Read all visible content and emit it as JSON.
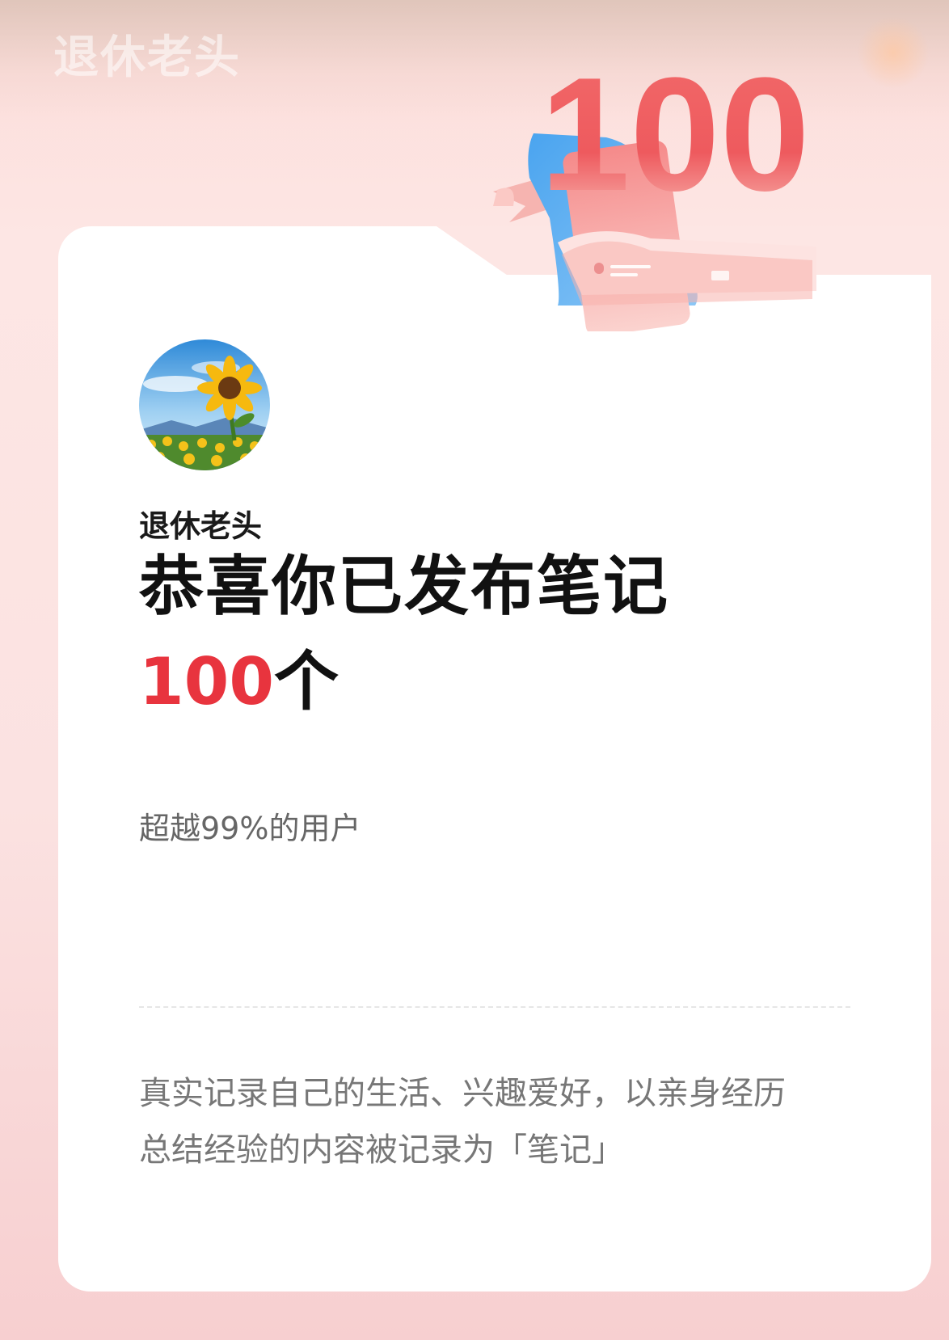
{
  "header": {
    "faded_username": "退休老头"
  },
  "badge": {
    "number": "100",
    "icon": "scroll-ribbon-badge-icon"
  },
  "profile": {
    "avatar_icon": "sunflower-avatar-icon",
    "username": "退休老头"
  },
  "milestone": {
    "headline": "恭喜你已发布笔记",
    "count": "100",
    "unit": "个",
    "rank_text": "超越99%的用户"
  },
  "description": {
    "line1": "真实记录自己的生活、兴趣爱好，以亲身经历",
    "line2": "总结经验的内容被记录为「笔记」"
  },
  "colors": {
    "accent_red": "#e8343e",
    "background_pink": "#fde6e4",
    "card": "#ffffff"
  }
}
